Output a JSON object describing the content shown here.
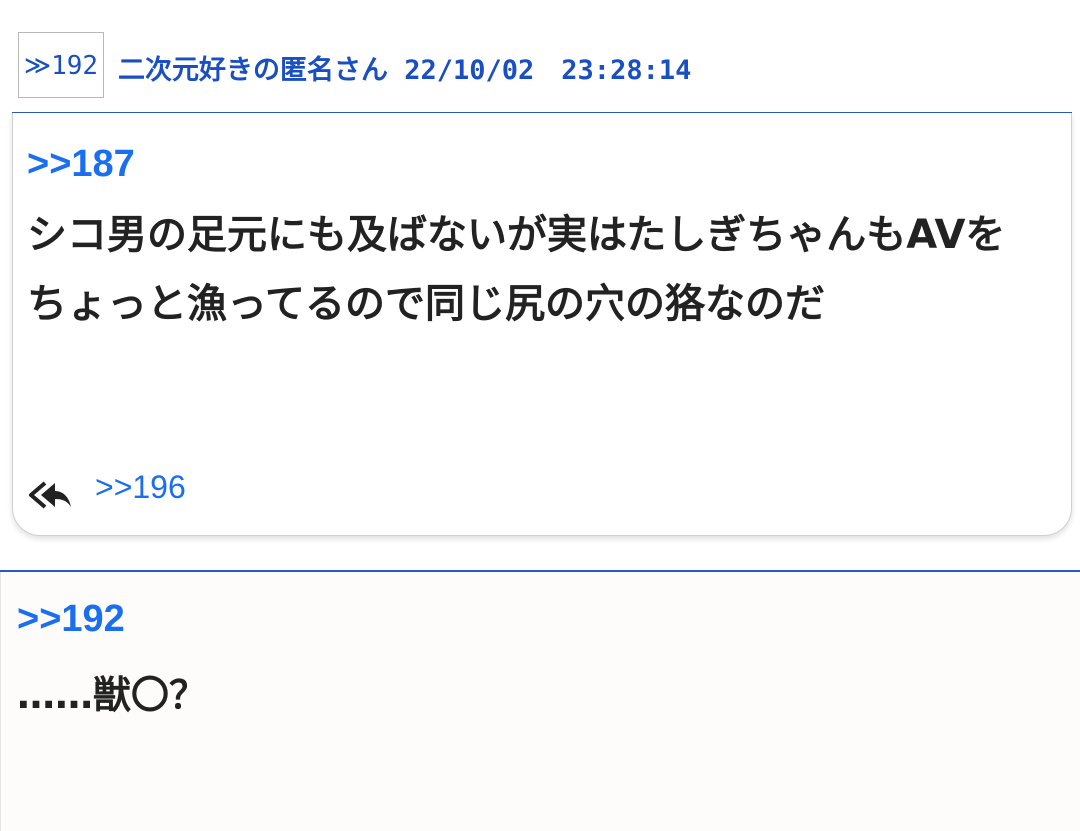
{
  "popup": {
    "anchor_number": "≫192",
    "anchor_meta": "二次元好きの匿名さん 22/10/02　23:28:14",
    "quote": ">>187",
    "body": "シコ男の足元にも及ばないが実はたしぎちゃんもAVをちょっと漁ってるので同じ尻の穴の狢なのだ",
    "reply_link": ">>196"
  },
  "post": {
    "quote": ">>192",
    "body": "……獣〇？"
  },
  "icons": {
    "reply": "reply-all-icon"
  },
  "colors": {
    "link": "#1a6ff0",
    "header": "#1a4fc4",
    "rule": "#2b58c8"
  }
}
